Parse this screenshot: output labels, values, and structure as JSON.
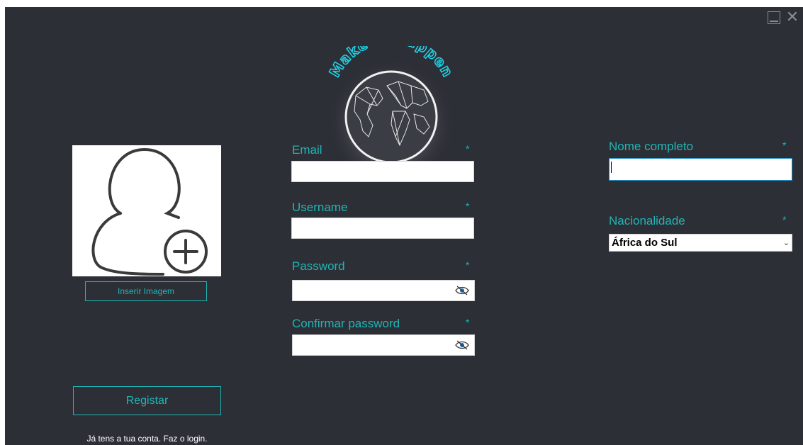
{
  "window": {
    "minimize_icon": "minimize-icon",
    "close_icon": "close-icon",
    "close_glyph": "✕"
  },
  "logo": {
    "text": "Make it Happen"
  },
  "avatar": {
    "icon": "add-user-icon",
    "insert_image_label": "Inserir Imagem"
  },
  "form": {
    "email": {
      "label": "Email",
      "required": "*",
      "value": ""
    },
    "username": {
      "label": "Username",
      "required": "*",
      "value": ""
    },
    "password": {
      "label": "Password",
      "required": "*",
      "value": "",
      "icon": "eye-slash-icon"
    },
    "confirm_password": {
      "label": "Confirmar password",
      "required": "*",
      "value": "",
      "icon": "eye-slash-icon"
    },
    "full_name": {
      "label": "Nome completo",
      "required": "*",
      "value": ""
    },
    "nationality": {
      "label": "Nacionalidade",
      "required": "*",
      "selected": "África do Sul"
    }
  },
  "actions": {
    "register_label": "Registar",
    "login_text": "Já tens a tua conta. Faz o login."
  },
  "colors": {
    "background": "#2d2f36",
    "accent": "#1fb5b5",
    "logo_glow": "#22d3e6"
  }
}
